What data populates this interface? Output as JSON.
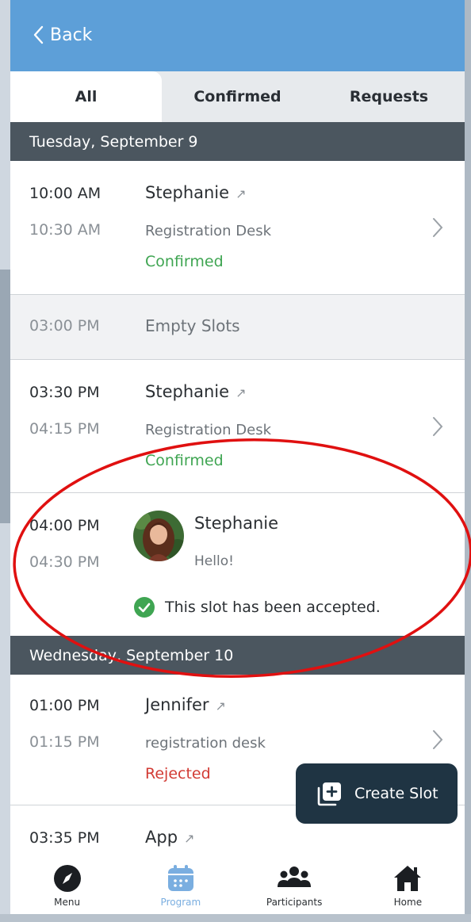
{
  "header": {
    "back_label": "Back"
  },
  "tabs": [
    {
      "label": "All",
      "active": true
    },
    {
      "label": "Confirmed",
      "active": false
    },
    {
      "label": "Requests",
      "active": false
    }
  ],
  "days": [
    {
      "label": "Tuesday, September 9",
      "slots": [
        {
          "start": "10:00 AM",
          "end": "10:30 AM",
          "name": "Stephanie",
          "location": "Registration Desk",
          "status": "Confirmed"
        },
        {
          "start": "03:00 PM",
          "label": "Empty Slots"
        },
        {
          "start": "03:30 PM",
          "end": "04:15 PM",
          "name": "Stephanie",
          "location": "Registration Desk",
          "status": "Confirmed"
        },
        {
          "start": "04:00 PM",
          "end": "04:30 PM",
          "name": "Stephanie",
          "message": "Hello!",
          "accepted_text": "This slot has been accepted."
        }
      ]
    },
    {
      "label": "Wednesday, September 10",
      "slots": [
        {
          "start": "01:00 PM",
          "end": "01:15 PM",
          "name": "Jennifer",
          "location": "registration desk",
          "status": "Rejected"
        },
        {
          "start": "03:35 PM",
          "name": "App"
        }
      ]
    }
  ],
  "fab": {
    "label": "Create Slot"
  },
  "bottom_nav": [
    {
      "label": "Menu",
      "icon": "compass-icon",
      "active": false
    },
    {
      "label": "Program",
      "icon": "calendar-icon",
      "active": true
    },
    {
      "label": "Participants",
      "icon": "people-icon",
      "active": false
    },
    {
      "label": "Home",
      "icon": "home-icon",
      "active": false
    }
  ],
  "colors": {
    "header_blue": "#5d9fd8",
    "day_header": "#4b565f",
    "confirmed_green": "#3fa552",
    "rejected_red": "#d23b34",
    "fab_dark": "#1f3443",
    "active_nav": "#7aaee0",
    "annotation_red": "#e01010"
  }
}
